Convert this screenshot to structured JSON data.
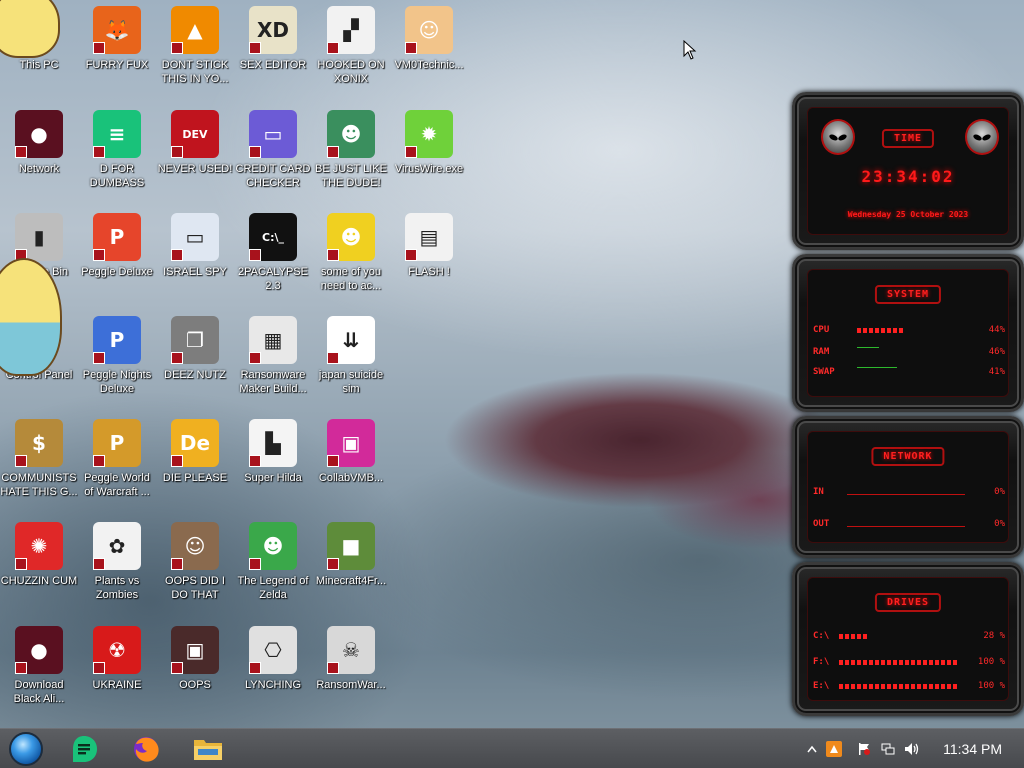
{
  "desktop_icons": [
    {
      "label": "This PC",
      "icon": "star-character-icon",
      "color": "#f6e27a",
      "glyph": ""
    },
    {
      "label": "FURRY FUX",
      "icon": "firefox-icon",
      "color": "#e8641b",
      "glyph": "🦊"
    },
    {
      "label": "DONT STICK THIS IN YO...",
      "icon": "vlc-cone-icon",
      "color": "#f08a00",
      "glyph": "▲"
    },
    {
      "label": "SEX EDITOR",
      "icon": "hxd-editor-icon",
      "color": "#e8e2c8",
      "glyph": "XD"
    },
    {
      "label": "HOOKED ON XONIX",
      "icon": "xonix-game-icon",
      "color": "#f2f2f2",
      "glyph": "▞"
    },
    {
      "label": "VM0Technic...",
      "icon": "doctor-icon",
      "color": "#f2c48a",
      "glyph": "☺"
    },
    {
      "label": "Network",
      "icon": "network-orb-icon",
      "color": "#5a1020",
      "glyph": "●"
    },
    {
      "label": "D FOR DUMBASS",
      "icon": "notes-app-icon",
      "color": "#19c27a",
      "glyph": "≡"
    },
    {
      "label": "NEVER USED!",
      "icon": "devcpp-icon",
      "color": "#c0141e",
      "glyph": "DEV"
    },
    {
      "label": "CREDIT CARD CHECKER",
      "icon": "credit-card-icon",
      "color": "#6c5bd6",
      "glyph": "▭"
    },
    {
      "label": "BE JUST LIKE THE DUDE!",
      "icon": "santa-dude-icon",
      "color": "#3a8f5e",
      "glyph": "☻"
    },
    {
      "label": "VirusWire.exe",
      "icon": "limewire-icon",
      "color": "#6fd13a",
      "glyph": "✹"
    },
    {
      "label": "Recycle Bin",
      "icon": "recycle-bin-icon",
      "color": "#bdbdbd",
      "glyph": "▮"
    },
    {
      "label": "Peggle Deluxe",
      "icon": "peggle-icon",
      "color": "#e6452b",
      "glyph": "P"
    },
    {
      "label": "ISRAEL SPY",
      "icon": "network-computer-icon",
      "color": "#dfe7f2",
      "glyph": "▭"
    },
    {
      "label": "2PACALYPSE 2.3",
      "icon": "cmd-terminal-icon",
      "color": "#111111",
      "glyph": "C:\\_"
    },
    {
      "label": "some of you need to ac...",
      "icon": "scooby-icon",
      "color": "#f0d020",
      "glyph": "☻"
    },
    {
      "label": "FLASH !",
      "icon": "flash-card-icon",
      "color": "#f2f2f2",
      "glyph": "▤"
    },
    {
      "label": "Control Panel",
      "icon": "star-character-icon",
      "color": "#f6e27a",
      "glyph": ""
    },
    {
      "label": "Peggle Nights Deluxe",
      "icon": "peggle-nights-icon",
      "color": "#3d6fd8",
      "glyph": "P"
    },
    {
      "label": "DEEZ NUTZ",
      "icon": "windows-stack-icon",
      "color": "#7d7d7d",
      "glyph": "❐"
    },
    {
      "label": "Ransomware Maker Build...",
      "icon": "window-app-icon",
      "color": "#e8e8e8",
      "glyph": "▦"
    },
    {
      "label": "japan suicide sim",
      "icon": "japan-sim-icon",
      "color": "#ffffff",
      "glyph": "⇊"
    },
    {
      "label": "COMMUNISTS HATE THIS G...",
      "icon": "money-bag-icon",
      "color": "#b58a3a",
      "glyph": "$"
    },
    {
      "label": "Peggle World of Warcraft ...",
      "icon": "peggle-wow-icon",
      "color": "#d49a2a",
      "glyph": "P"
    },
    {
      "label": "DIE PLEASE",
      "icon": "directx-icon",
      "color": "#f0b020",
      "glyph": "De"
    },
    {
      "label": "Super Hilda",
      "icon": "pixel-dog-icon",
      "color": "#f4f4f4",
      "glyph": "▙"
    },
    {
      "label": "CollabVMB...",
      "icon": "collabvm-icon",
      "color": "#d22a9a",
      "glyph": "▣"
    },
    {
      "label": "CHUZZIN CUM",
      "icon": "chuzzle-icon",
      "color": "#e02828",
      "glyph": "✺"
    },
    {
      "label": "Plants vs Zombies",
      "icon": "pvz-flower-icon",
      "color": "#f2f2f2",
      "glyph": "✿"
    },
    {
      "label": "OOPS DID I DO THAT",
      "icon": "portrait-icon",
      "color": "#8a6a4e",
      "glyph": "☺"
    },
    {
      "label": "The Legend of Zelda",
      "icon": "zelda-link-icon",
      "color": "#3aa84a",
      "glyph": "☻"
    },
    {
      "label": "Minecraft4Fr...",
      "icon": "minecraft-grass-icon",
      "color": "#5e8c3a",
      "glyph": "■"
    },
    {
      "label": "Download Black Ali...",
      "icon": "alien-orb-icon",
      "color": "#5a1020",
      "glyph": "●"
    },
    {
      "label": "UKRAINE",
      "icon": "radiation-icon",
      "color": "#d81a1a",
      "glyph": "☢"
    },
    {
      "label": "OOPS",
      "icon": "dark-media-icon",
      "color": "#4a2a2a",
      "glyph": "▣"
    },
    {
      "label": "LYNCHING",
      "icon": "hook-russia-icon",
      "color": "#e0e0e0",
      "glyph": "⎔"
    },
    {
      "label": "RansomWar...",
      "icon": "skull-icon",
      "color": "#d8d8d8",
      "glyph": "☠"
    }
  ],
  "gadget": {
    "time_title": "TIME",
    "time": "23:34:02",
    "date": "Wednesday 25 October 2023",
    "system_title": "SYSTEM",
    "cpu_label": "CPU",
    "cpu_value": "44%",
    "ram_label": "RAM",
    "ram_value": "46%",
    "swap_label": "SWAP",
    "swap_value": "41%",
    "network_title": "NETWORK",
    "in_label": "IN",
    "in_value": "0%",
    "out_label": "OUT",
    "out_value": "0%",
    "drives_title": "DRIVES",
    "drive_c_label": "C:\\",
    "drive_c_value": "28 %",
    "drive_f_label": "F:\\",
    "drive_f_value": "100 %",
    "drive_e_label": "E:\\",
    "drive_e_value": "100 %",
    "accent_color": "#ff1a1a"
  },
  "taskbar": {
    "pinned": [
      {
        "name": "notes-app-icon"
      },
      {
        "name": "firefox-icon"
      },
      {
        "name": "file-explorer-icon"
      }
    ],
    "clock": "11:34 PM"
  }
}
